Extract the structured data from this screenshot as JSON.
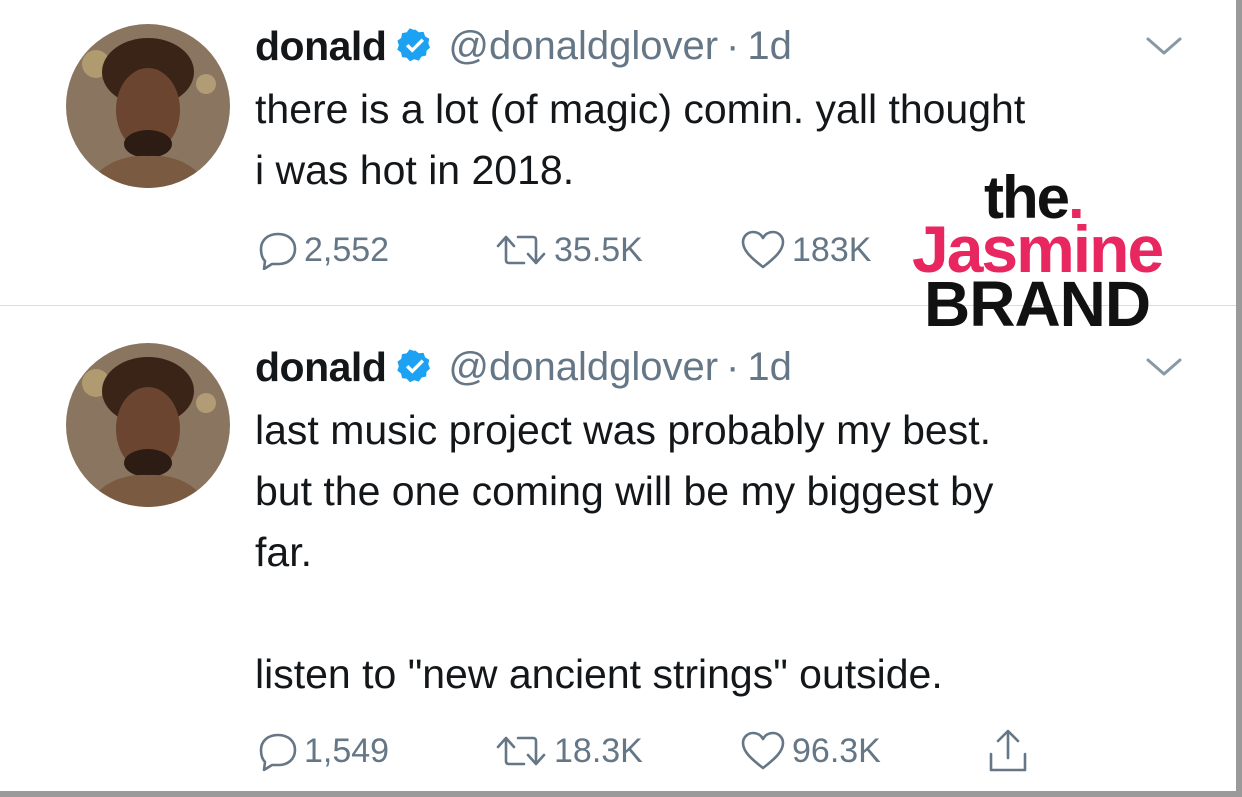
{
  "tweets": [
    {
      "display_name": "donald",
      "handle": "@donaldglover",
      "separator": "·",
      "time": "1d",
      "text": "there is a lot (of magic) comin. yall thought\ni was hot in 2018.",
      "replies": "2,552",
      "retweets": "35.5K",
      "likes": "183K"
    },
    {
      "display_name": "donald",
      "handle": "@donaldglover",
      "separator": "·",
      "time": "1d",
      "text": "last music project was probably my best.\nbut the one coming will be my biggest by\nfar.\n\nlisten to \"new ancient strings\" outside.",
      "replies": "1,549",
      "retweets": "18.3K",
      "likes": "96.3K"
    }
  ],
  "watermark": {
    "line1": "the",
    "line1_dot": ".",
    "line2": "Jasmine",
    "line3": "BRAND"
  },
  "icons": {
    "verified": "verified-badge-icon",
    "caret": "chevron-down-icon",
    "reply": "reply-icon",
    "retweet": "retweet-icon",
    "like": "heart-icon",
    "share": "share-icon"
  },
  "colors": {
    "text": "#14171a",
    "secondary": "#657786",
    "verified": "#1da1f2",
    "brand_pink": "#e8265f"
  }
}
